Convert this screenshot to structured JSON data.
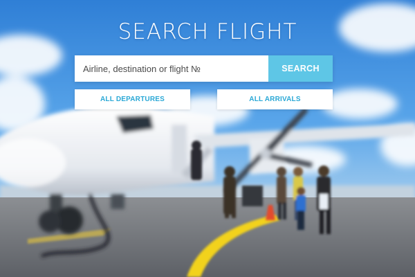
{
  "hero": {
    "title": "SEARCH FLIGHT",
    "background": "blurred-airport-apron-with-propeller-plane-and-boarding-passengers"
  },
  "search": {
    "placeholder": "Airline, destination or flight №",
    "value": "",
    "button_label": "SEARCH"
  },
  "filters": {
    "departures_label": "ALL DEPARTURES",
    "arrivals_label": "ALL ARRIVALS"
  },
  "colors": {
    "sky": "#3a8ee0",
    "accent_button": "#5ec6e6",
    "link_text": "#2aa8d6",
    "button_bg": "#ffffff",
    "title_text": "#ffffff",
    "taxi_line": "#f2d21b"
  }
}
